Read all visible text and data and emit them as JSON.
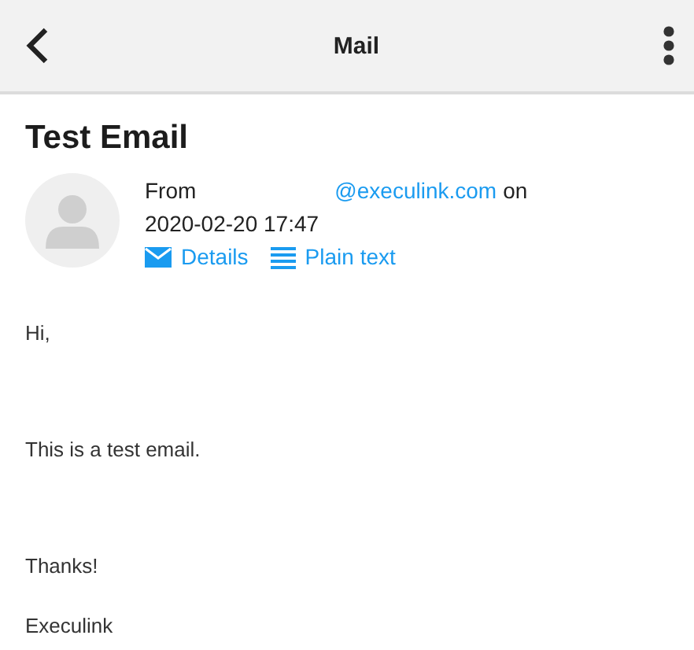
{
  "app_bar": {
    "title": "Mail"
  },
  "message": {
    "subject": "Test Email",
    "from_label": "From",
    "sender": "@execulink.com",
    "on_label": "on",
    "date": "2020-02-20 17:47",
    "actions": [
      {
        "kind": "details",
        "label": "Details"
      },
      {
        "kind": "plain",
        "label": "Plain text"
      }
    ],
    "body": [
      "Hi,",
      "This is a test email.",
      "Thanks!",
      "Execulink"
    ]
  }
}
